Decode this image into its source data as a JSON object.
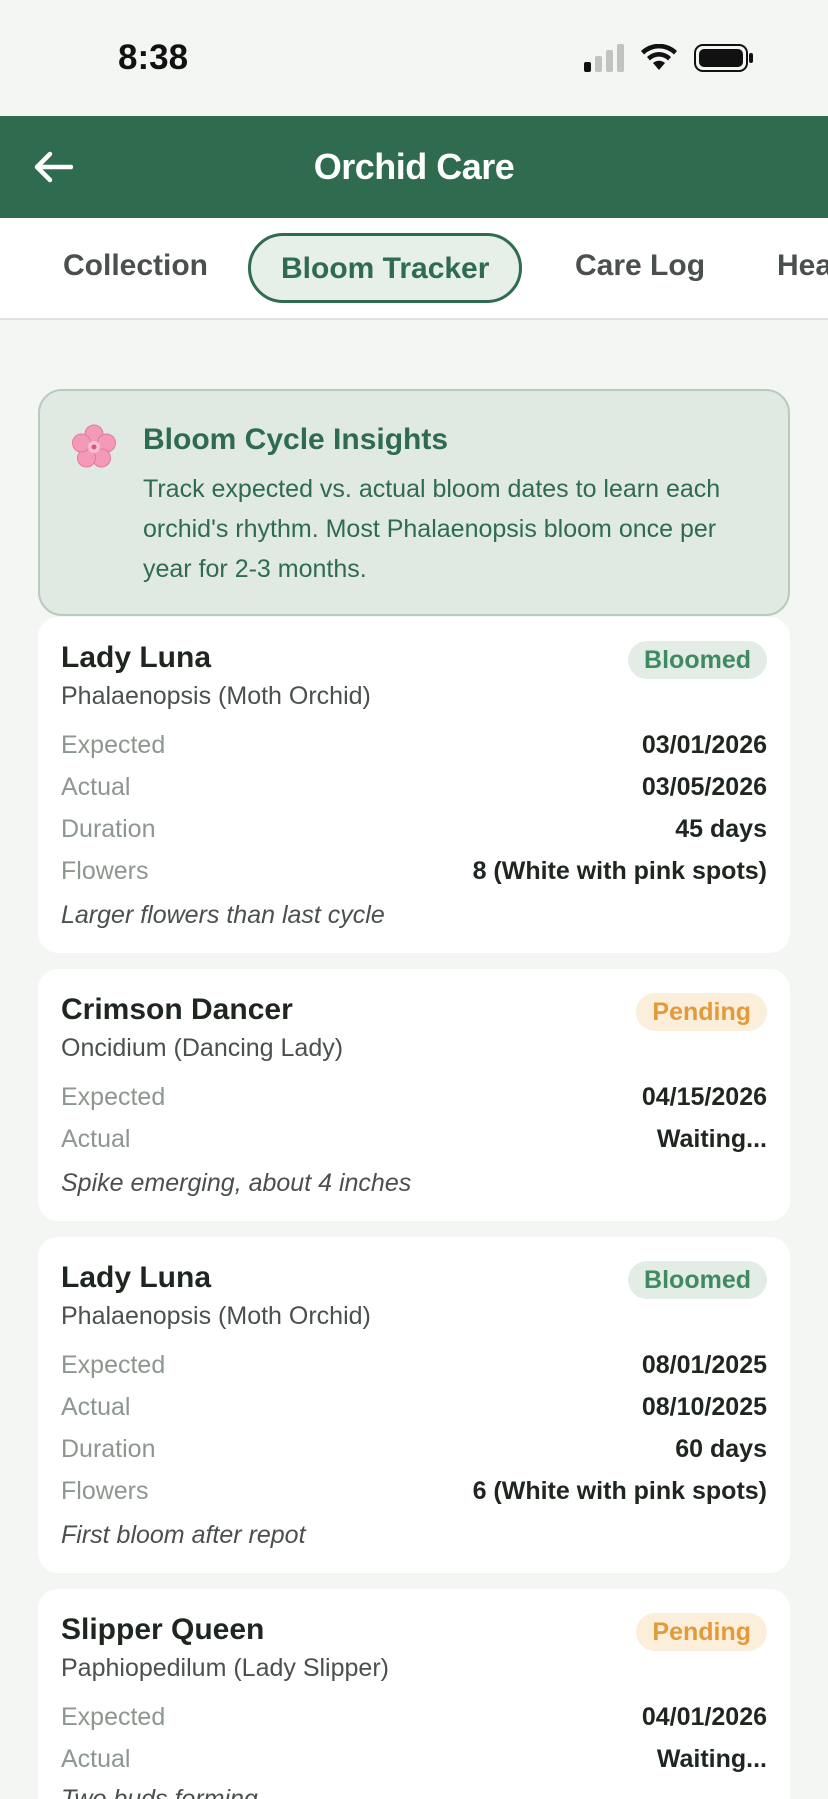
{
  "status": {
    "time": "8:38"
  },
  "header": {
    "title": "Orchid Care",
    "back_icon": "arrow-left-icon"
  },
  "tabs": [
    {
      "label": "Collection",
      "active": false
    },
    {
      "label": "Bloom Tracker",
      "active": true
    },
    {
      "label": "Care Log",
      "active": false
    },
    {
      "label": "Hea",
      "active": false
    }
  ],
  "insight": {
    "icon": "flower-icon",
    "title": "Bloom Cycle Insights",
    "text": "Track expected vs. actual bloom dates to learn each orchid's rhythm. Most Phalaenopsis bloom once per year for 2-3 months."
  },
  "labels": {
    "expected": "Expected",
    "actual": "Actual",
    "duration": "Duration",
    "flowers": "Flowers"
  },
  "cards": [
    {
      "name": "Lady Luna",
      "species": "Phalaenopsis (Moth Orchid)",
      "status": "Bloomed",
      "expected": "03/01/2026",
      "actual": "03/05/2026",
      "duration": "45 days",
      "flowers": "8 (White with pink spots)",
      "note": "Larger flowers than last cycle"
    },
    {
      "name": "Crimson Dancer",
      "species": "Oncidium (Dancing Lady)",
      "status": "Pending",
      "expected": "04/15/2026",
      "actual": "Waiting...",
      "note": "Spike emerging, about 4 inches"
    },
    {
      "name": "Lady Luna",
      "species": "Phalaenopsis (Moth Orchid)",
      "status": "Bloomed",
      "expected": "08/01/2025",
      "actual": "08/10/2025",
      "duration": "60 days",
      "flowers": "6 (White with pink spots)",
      "note": "First bloom after repot"
    },
    {
      "name": "Slipper Queen",
      "species": "Paphiopedilum (Lady Slipper)",
      "status": "Pending",
      "expected": "04/01/2026",
      "actual": "Waiting...",
      "note": "Two buds forming"
    }
  ],
  "colors": {
    "primary": "#2e6b4f",
    "bloomed": "#3f8a63",
    "pending": "#e29a3a",
    "background": "#f3f6f2"
  }
}
